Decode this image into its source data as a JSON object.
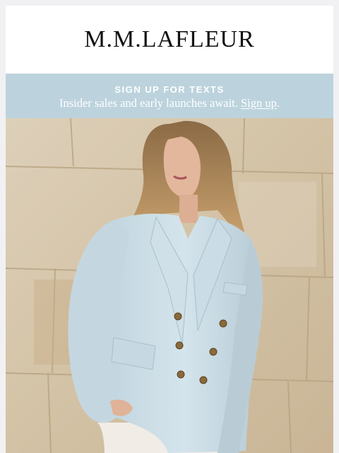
{
  "brand": {
    "logo_text": "M.M.LAFLEUR"
  },
  "banner": {
    "title": "SIGN UP FOR TEXTS",
    "text_before_link": "Insider sales and early launches await. ",
    "link_label": "Sign up",
    "text_after_link": ".",
    "background_color": "#bcd3dd"
  },
  "hero": {
    "description_icon": "model-in-light-blue-blazer-photo"
  }
}
